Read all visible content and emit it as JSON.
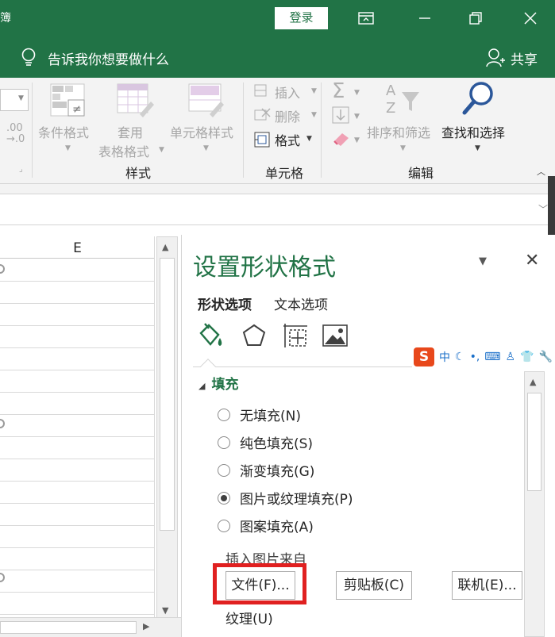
{
  "titlebar": {
    "edge_text": "簿",
    "login_label": "登录",
    "colors": {
      "brand": "#217346"
    }
  },
  "tellbar": {
    "tell_me": "告诉我你想要做什么",
    "share": "共享"
  },
  "ribbon": {
    "cond_format": "条件格式",
    "table_format_1": "套用",
    "table_format_2": "表格格式",
    "cell_style": "单元格样式",
    "group_styles": "样式",
    "insert": "插入",
    "delete": "删除",
    "format": "格式",
    "group_cells": "单元格",
    "sort_filter": "排序和筛选",
    "find_select": "查找和选择",
    "group_edit": "编辑",
    "num_dec": ".00",
    "num_dec2": "→.0"
  },
  "sheet": {
    "column_header": "E"
  },
  "pane": {
    "title": "设置形状格式",
    "tab_shape": "形状选项",
    "tab_text": "文本选项",
    "section_fill": "填充",
    "options": [
      {
        "label": "无填充(N)",
        "selected": false
      },
      {
        "label": "纯色填充(S)",
        "selected": false
      },
      {
        "label": "渐变填充(G)",
        "selected": false
      },
      {
        "label": "图片或纹理填充(P)",
        "selected": true
      },
      {
        "label": "图案填充(A)",
        "selected": false
      }
    ],
    "insert_from": "插入图片来自",
    "btn_file": "文件(F)...",
    "btn_clipboard": "剪贴板(C)",
    "btn_online": "联机(E)...",
    "texture": "纹理(U)"
  },
  "ime": {
    "logo": "S",
    "lang": "中"
  }
}
